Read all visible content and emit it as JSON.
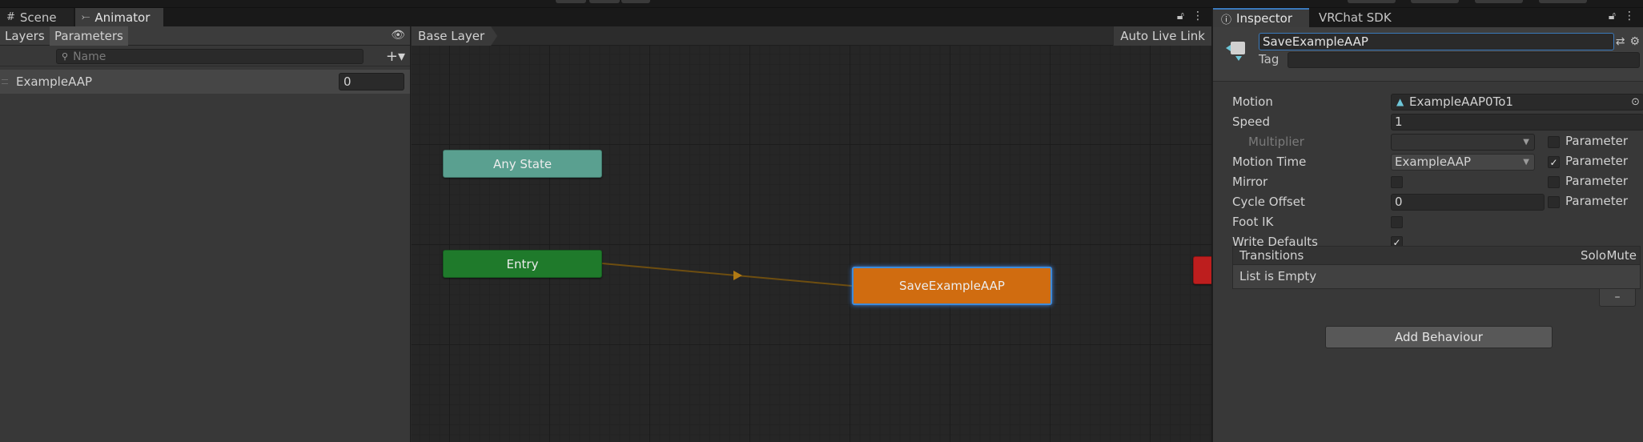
{
  "left_window": {
    "tabs": [
      {
        "label": "Scene",
        "icon": "grid-icon"
      },
      {
        "label": "Animator",
        "icon": "animator-icon"
      }
    ]
  },
  "animator": {
    "subtabs": [
      "Layers",
      "Parameters"
    ],
    "search_placeholder": "Name",
    "parameters": [
      {
        "name": "ExampleAAP",
        "value": "0"
      }
    ],
    "breadcrumb": "Base Layer",
    "auto_live_link": "Auto Live Link",
    "nodes": {
      "any_state": "Any State",
      "entry": "Entry",
      "selected": "SaveExampleAAP"
    },
    "colors": {
      "any_state": "#5aa090",
      "entry": "#1f7a2b",
      "selected": "#d06c10",
      "exit": "#bd1e1e",
      "transition": "#6e4e10"
    }
  },
  "inspector": {
    "tabs": [
      {
        "label": "Inspector",
        "icon": "info-icon"
      },
      {
        "label": "VRChat SDK",
        "icon": ""
      }
    ],
    "state_name": "SaveExampleAAP",
    "tag_label": "Tag",
    "tag_value": "",
    "properties": {
      "motion_label": "Motion",
      "motion_value": "ExampleAAP0To1",
      "speed_label": "Speed",
      "speed_value": "1",
      "multiplier_label": "Multiplier",
      "motion_time_label": "Motion Time",
      "motion_time_value": "ExampleAAP",
      "mirror_label": "Mirror",
      "cycle_offset_label": "Cycle Offset",
      "cycle_offset_value": "0",
      "foot_ik_label": "Foot IK",
      "write_defaults_label": "Write Defaults",
      "parameter_label": "Parameter"
    },
    "checks": {
      "multiplier_param": false,
      "motion_time_param": true,
      "mirror": false,
      "mirror_param": false,
      "cycle_offset_param": false,
      "foot_ik": false,
      "write_defaults": true
    },
    "transitions": {
      "header": "Transitions",
      "solo": "Solo",
      "mute": "Mute",
      "empty": "List is Empty",
      "remove": "–"
    },
    "add_behaviour": "Add Behaviour"
  }
}
